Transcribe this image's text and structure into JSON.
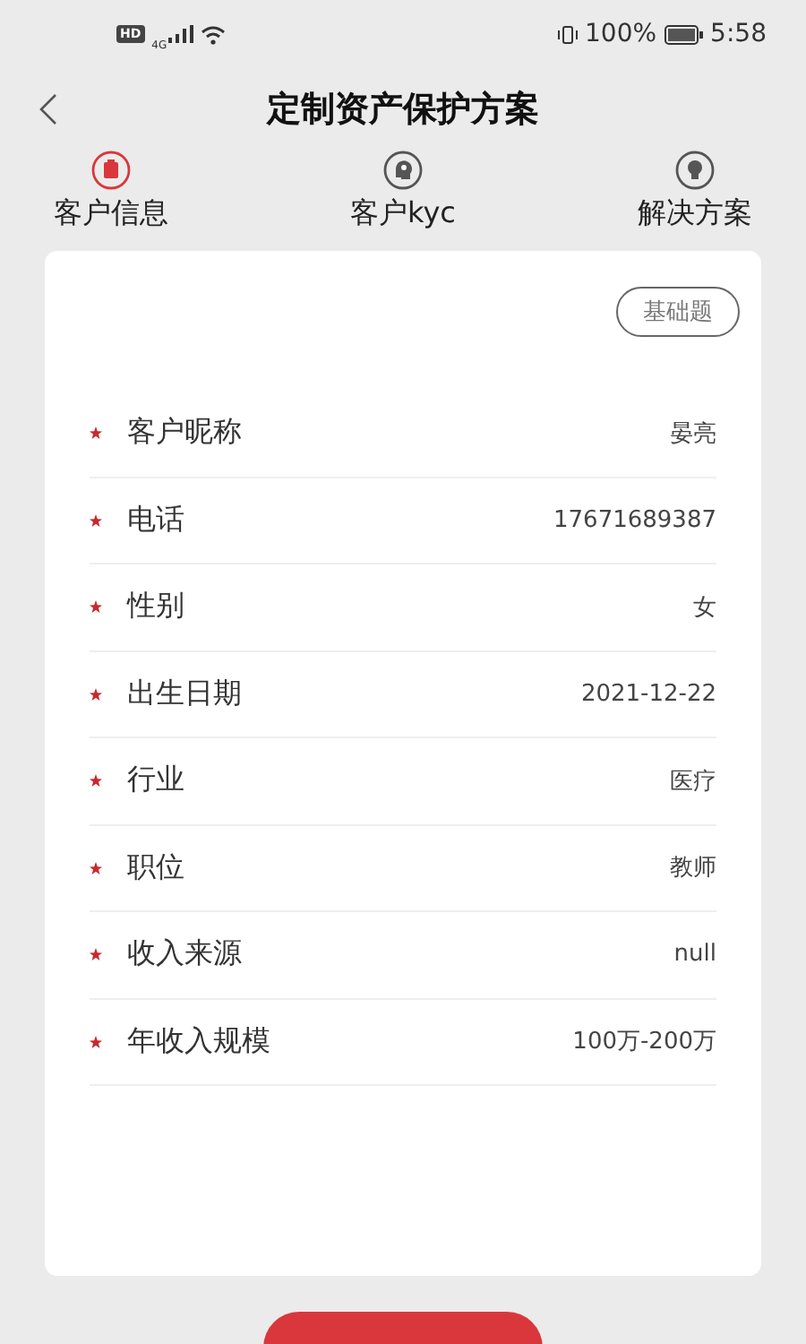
{
  "status_bar": {
    "network_badge": "HD",
    "network_type": "4G",
    "battery": "100%",
    "time": "5:58"
  },
  "header": {
    "title": "定制资产保护方案"
  },
  "tabs": [
    {
      "label": "客户信息",
      "kind": "clipboard",
      "selected": true
    },
    {
      "label": "客户kyc",
      "kind": "head",
      "selected": false
    },
    {
      "label": "解决方案",
      "kind": "bulb",
      "selected": false
    }
  ],
  "card": {
    "tag": "基础题",
    "fields": [
      {
        "label": "客户昵称",
        "value": "晏亮",
        "required": true
      },
      {
        "label": "电话",
        "value": "17671689387",
        "required": true
      },
      {
        "label": "性别",
        "value": "女",
        "required": true
      },
      {
        "label": "出生日期",
        "value": "2021-12-22",
        "required": true
      },
      {
        "label": "行业",
        "value": "医疗",
        "required": true
      },
      {
        "label": "职位",
        "value": "教师",
        "required": true
      },
      {
        "label": "收入来源",
        "value": "null",
        "required": true
      },
      {
        "label": "年收入规模",
        "value": "100万-200万",
        "required": true
      }
    ]
  }
}
